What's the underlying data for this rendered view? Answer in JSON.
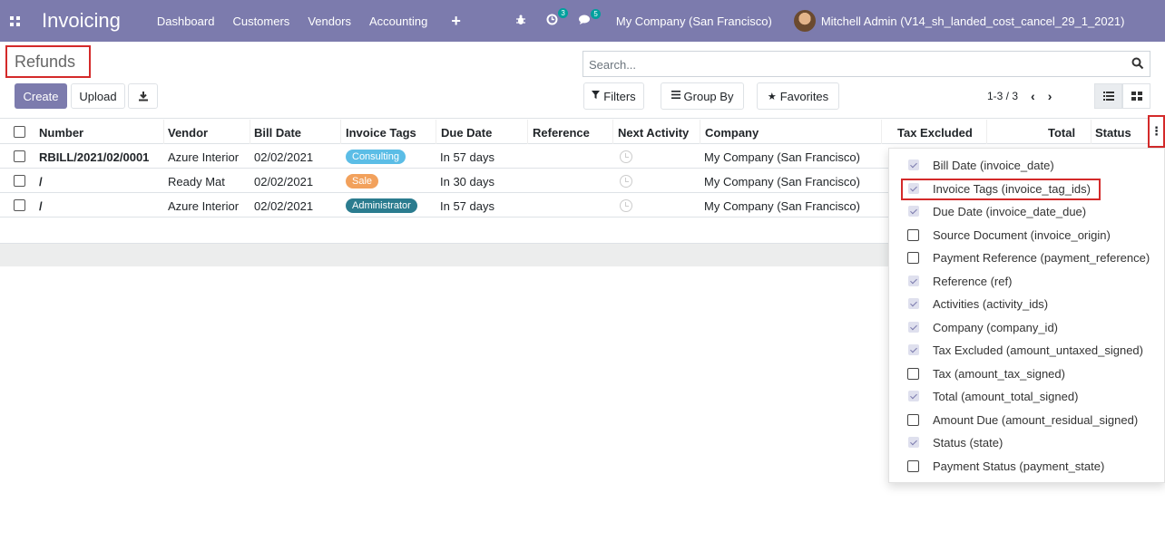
{
  "navbar": {
    "brand": "Invoicing",
    "menu": [
      "Dashboard",
      "Customers",
      "Vendors",
      "Accounting"
    ],
    "plus": "+",
    "activity_badge": "3",
    "message_badge": "5",
    "company": "My Company (San Francisco)",
    "user": "Mitchell Admin (V14_sh_landed_cost_cancel_29_1_2021)",
    "bg_color": "#7c7bad"
  },
  "control": {
    "breadcrumb": "Refunds",
    "search_placeholder": "Search...",
    "create_label": "Create",
    "upload_label": "Upload",
    "filters_label": "Filters",
    "groupby_label": "Group By",
    "favorites_label": "Favorites",
    "pager": "1-3 / 3"
  },
  "table": {
    "headers": [
      "Number",
      "Vendor",
      "Bill Date",
      "Invoice Tags",
      "Due Date",
      "Reference",
      "Next Activity",
      "Company",
      "Tax Excluded",
      "Total",
      "Status"
    ],
    "rows": [
      {
        "number": "RBILL/2021/02/0001",
        "vendor": "Azure Interior",
        "bill_date": "02/02/2021",
        "tag": "Consulting",
        "tag_color": "#5bbde6",
        "due": "In 57 days",
        "company": "My Company (San Francisco)"
      },
      {
        "number": "/",
        "vendor": "Ready Mat",
        "bill_date": "02/02/2021",
        "tag": "Sale",
        "tag_color": "#f2a15c",
        "due": "In 30 days",
        "company": "My Company (San Francisco)"
      },
      {
        "number": "/",
        "vendor": "Azure Interior",
        "bill_date": "02/02/2021",
        "tag": "Administrator",
        "tag_color": "#2b7c8f",
        "due": "In 57 days",
        "company": "My Company (San Francisco)"
      }
    ]
  },
  "column_menu": {
    "items": [
      {
        "label": "Bill Date (invoice_date)",
        "checked": true
      },
      {
        "label": "Invoice Tags (invoice_tag_ids)",
        "checked": true
      },
      {
        "label": "Due Date (invoice_date_due)",
        "checked": true
      },
      {
        "label": "Source Document (invoice_origin)",
        "checked": false
      },
      {
        "label": "Payment Reference (payment_reference)",
        "checked": false
      },
      {
        "label": "Reference (ref)",
        "checked": true
      },
      {
        "label": "Activities (activity_ids)",
        "checked": true
      },
      {
        "label": "Company (company_id)",
        "checked": true
      },
      {
        "label": "Tax Excluded (amount_untaxed_signed)",
        "checked": true
      },
      {
        "label": "Tax (amount_tax_signed)",
        "checked": false
      },
      {
        "label": "Total (amount_total_signed)",
        "checked": true
      },
      {
        "label": "Amount Due (amount_residual_signed)",
        "checked": false
      },
      {
        "label": "Status (state)",
        "checked": true
      },
      {
        "label": "Payment Status (payment_state)",
        "checked": false
      }
    ]
  }
}
